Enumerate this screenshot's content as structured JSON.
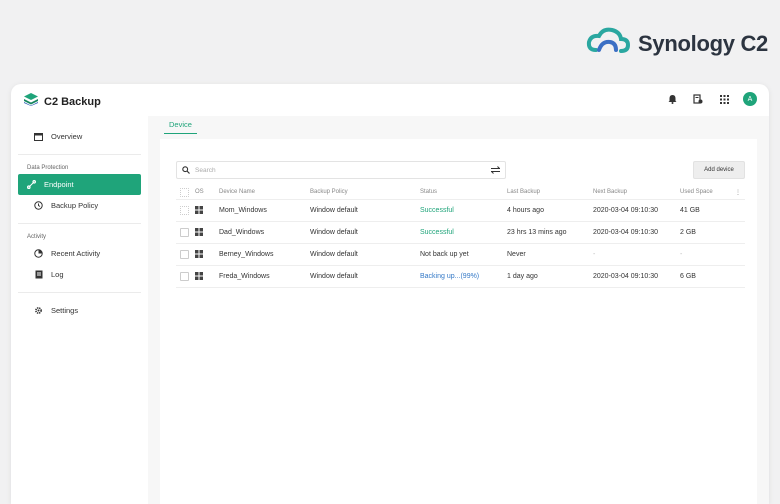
{
  "brand": {
    "name": "Synology C2"
  },
  "app": {
    "title": "C2 Backup",
    "avatar_letter": "A"
  },
  "sidebar": {
    "overview": "Overview",
    "data_protection_label": "Data Protection",
    "endpoint": "Endpoint",
    "backup_policy": "Backup Policy",
    "activity_label": "Activity",
    "recent_activity": "Recent Activity",
    "log": "Log",
    "settings": "Settings"
  },
  "main": {
    "tab": "Device",
    "search_placeholder": "Search",
    "add_device": "Add device",
    "columns": [
      "OS",
      "Device Name",
      "Backup Policy",
      "Status",
      "Last Backup",
      "Next Backup",
      "Used Space"
    ],
    "rows": [
      {
        "name": "Mom_Windows",
        "policy": "Window default",
        "status": "Successful",
        "last": "4 hours  ago",
        "next": "2020-03-04 09:10:30",
        "space": "41 GB"
      },
      {
        "name": "Dad_Windows",
        "policy": "Window default",
        "status": "Successful",
        "last": "23 hrs 13 mins ago",
        "next": "2020-03-04 09:10:30",
        "space": "2 GB"
      },
      {
        "name": "Berney_Windows",
        "policy": "Window default",
        "status": "Not back up yet",
        "last": "Never",
        "next": "-",
        "space": "-"
      },
      {
        "name": "Freda_Windows",
        "policy": "Window default",
        "status": "Backing up...(99%)",
        "last": "1 day ago",
        "next": "2020-03-04 09:10:30",
        "space": "6 GB"
      }
    ]
  },
  "colors": {
    "accent": "#1fa47a",
    "progress": "#3479c7"
  },
  "icons": [
    "synology-cloud-logo",
    "c2-backup-logo",
    "bell-icon",
    "task-icon",
    "apps-grid-icon",
    "overview-icon",
    "endpoint-icon",
    "backup-policy-icon",
    "recent-activity-icon",
    "log-icon",
    "settings-icon",
    "search-icon",
    "filter-icon",
    "windows-icon"
  ]
}
